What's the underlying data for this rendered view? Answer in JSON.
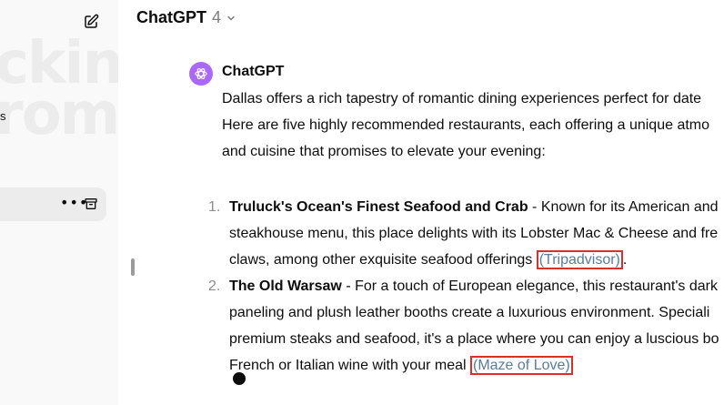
{
  "sidebar": {
    "background_art": [
      "ckin",
      "rom"
    ],
    "fragment_text": "s",
    "active_item": {
      "more_label": "•••"
    }
  },
  "header": {
    "model_name": "ChatGPT",
    "model_version": "4"
  },
  "message": {
    "sender": "ChatGPT",
    "intro_lines": [
      "Dallas offers a rich tapestry of romantic dining experiences perfect for date",
      "Here are five highly recommended restaurants, each offering a unique atmo",
      "and cuisine that promises to elevate your evening:"
    ],
    "items": [
      {
        "number": "1.",
        "name": "Truluck's Ocean's Finest Seafood and Crab",
        "line1_rest": " - Known for its American and",
        "line2": "steakhouse menu, this place delights with its Lobster Mac & Cheese and fre",
        "line3_pre": "claws, among other exquisite seafood offerings ",
        "citation": "(Tripadvisor)",
        "line3_post": "."
      },
      {
        "number": "2.",
        "name": "The Old Warsaw",
        "line1_rest": " - For a touch of European elegance, this restaurant's dark",
        "line2": "paneling and plush leather booths create a luxurious environment. Speciali",
        "line3": "premium steaks and seafood, it's a place where you can enjoy a luscious bo",
        "line4_pre": "French or Italian wine with your meal ",
        "citation": "(Maze of Love)",
        "line4_post": ""
      }
    ]
  },
  "colors": {
    "sidebar_bg": "#f9f9f9",
    "avatar_bg": "#ab68ff",
    "citation_text": "#5b7b9b",
    "highlight_border": "#d9302a"
  }
}
